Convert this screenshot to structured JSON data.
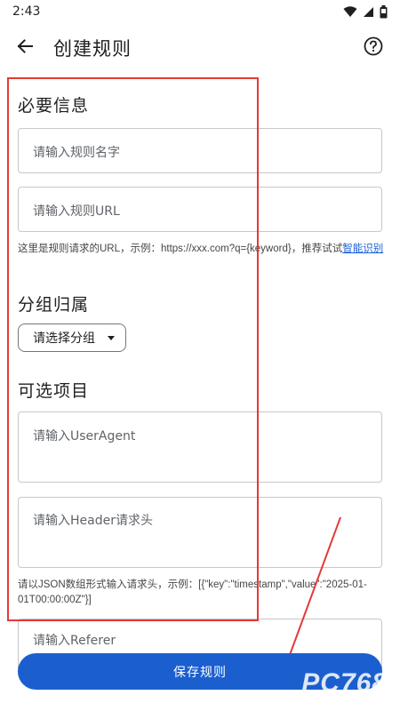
{
  "status_bar": {
    "time": "2:43"
  },
  "header": {
    "title": "创建规则"
  },
  "sections": {
    "required": "必要信息",
    "group": "分组归属",
    "optional": "可选项目"
  },
  "fields": {
    "rule_name": {
      "placeholder": "请输入规则名字",
      "value": ""
    },
    "rule_url": {
      "placeholder": "请输入规则URL",
      "value": ""
    },
    "user_agent": {
      "placeholder": "请输入UserAgent",
      "value": ""
    },
    "header": {
      "placeholder": "请输入Header请求头",
      "value": ""
    },
    "referer": {
      "placeholder": "请输入Referer",
      "value": ""
    }
  },
  "helpers": {
    "url_hint_prefix": "这里是规则请求的URL，示例：https://xxx.com?q={keyword}，推荐试试",
    "url_hint_link": "智能识别",
    "header_hint": "请以JSON数组形式输入请求头，示例：[{\"key\":\"timestamp\",\"value\":\"2025-01-01T00:00:00Z\"}]"
  },
  "group_select": {
    "selected": "请选择分组"
  },
  "actions": {
    "save_label": "保存规则"
  },
  "watermark": "PC768",
  "colors": {
    "accent": "#1b5fcf",
    "annotation": "#e53935"
  },
  "icons": {
    "back": "arrow-back-icon",
    "help": "help-circle-icon",
    "wifi": "wifi-icon",
    "signal": "signal-icon",
    "battery": "battery-icon",
    "dropdown": "caret-down-icon"
  }
}
